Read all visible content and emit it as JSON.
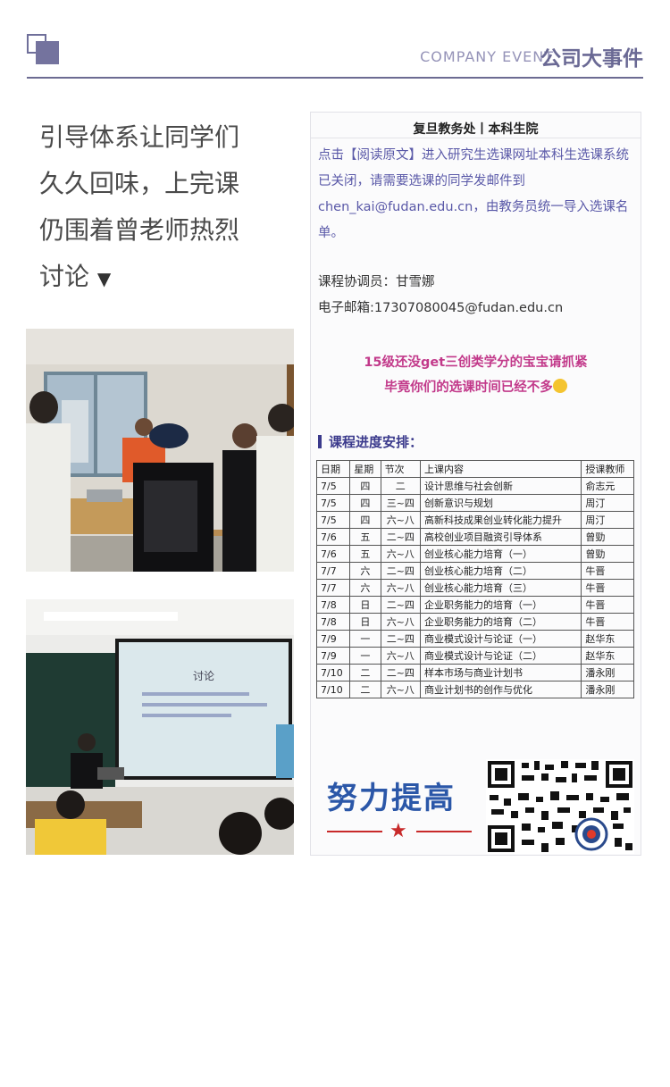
{
  "header": {
    "en_title": "COMPANY EVENT",
    "cn_title": "公司大事件"
  },
  "caption": {
    "text": "引导体系让同学们久久回味，上完课仍围着曾老师热烈讨论",
    "arrow": "▼"
  },
  "notice": {
    "source": "复旦教务处丨本科生院",
    "paragraph": "点击【阅读原文】进入研究生选课网址本科生选课系统已关闭，请需要选课的同学发邮件到chen_kai@fudan.edu.cn，由教务员统一导入选课名单。",
    "coordinator": "课程协调员：甘雪娜",
    "email": "电子邮箱:17307080045@fudan.edu.cn",
    "promo_line1": "15级还没get三创类学分的宝宝请抓紧",
    "promo_line2": "毕竟你们的选课时间已经不多",
    "schedule_title": "课程进度安排：",
    "table": {
      "headers": [
        "日期",
        "星期",
        "节次",
        "上课内容",
        "授课教师"
      ],
      "rows": [
        [
          "7/5",
          "四",
          "二",
          "设计思维与社会创新",
          "俞志元"
        ],
        [
          "7/5",
          "四",
          "三~四",
          "创新意识与规划",
          "周汀"
        ],
        [
          "7/5",
          "四",
          "六~八",
          "高新科技成果创业转化能力提升",
          "周汀"
        ],
        [
          "7/6",
          "五",
          "二~四",
          "高校创业项目融资引导体系",
          "曾勁"
        ],
        [
          "7/6",
          "五",
          "六~八",
          "创业核心能力培育（一）",
          "曾勁"
        ],
        [
          "7/7",
          "六",
          "二~四",
          "创业核心能力培育（二）",
          "牛晋"
        ],
        [
          "7/7",
          "六",
          "六~八",
          "创业核心能力培育（三）",
          "牛晋"
        ],
        [
          "7/8",
          "日",
          "二~四",
          "企业职务能力的培育（一）",
          "牛晋"
        ],
        [
          "7/8",
          "日",
          "六~八",
          "企业职务能力的培育（二）",
          "牛晋"
        ],
        [
          "7/9",
          "一",
          "二~四",
          "商业模式设计与论证（一）",
          "赵华东"
        ],
        [
          "7/9",
          "一",
          "六~八",
          "商业模式设计与论证（二）",
          "赵华东"
        ],
        [
          "7/10",
          "二",
          "二~四",
          "样本市场与商业计划书",
          "潘永刚"
        ],
        [
          "7/10",
          "二",
          "六~八",
          "商业计划书的创作与优化",
          "潘永刚"
        ]
      ]
    },
    "slogan": "努力提高"
  },
  "photos": {
    "screen_title": "讨论"
  },
  "colors": {
    "accent": "#6c6b92",
    "link": "#5a59a8",
    "promo": "#c2398a",
    "slogan": "#2b57a8"
  }
}
